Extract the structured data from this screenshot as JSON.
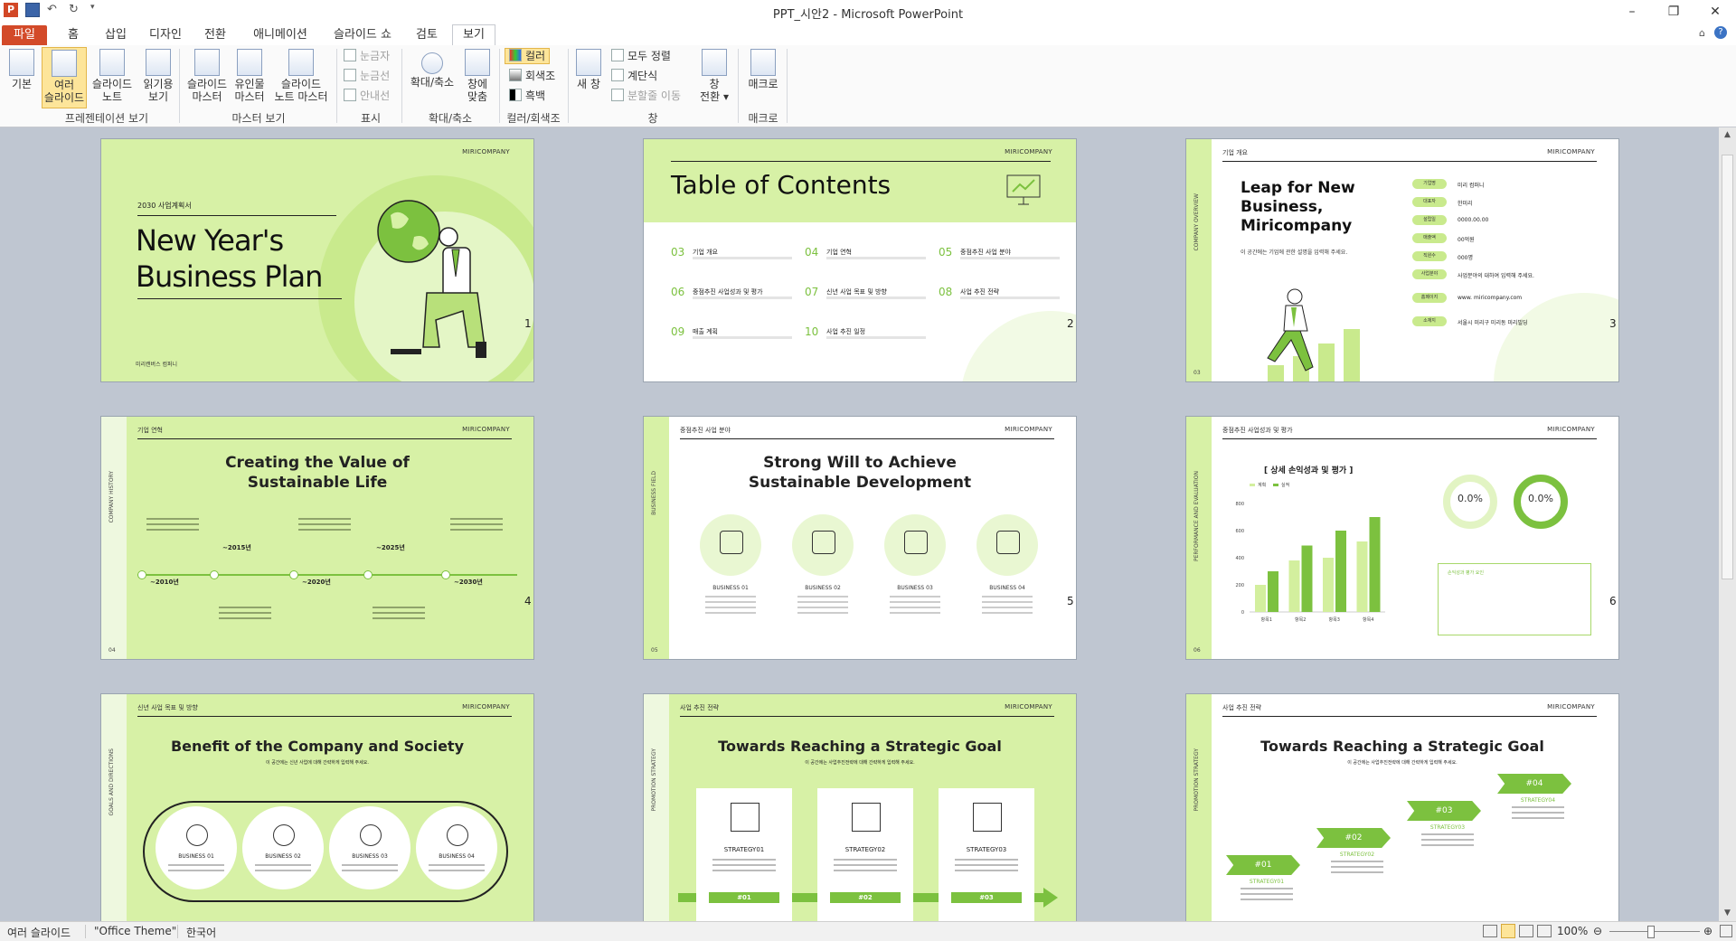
{
  "window": {
    "title": "PPT_시안2  -  Microsoft PowerPoint"
  },
  "tabs": [
    {
      "label": "파일"
    },
    {
      "label": "홈"
    },
    {
      "label": "삽입"
    },
    {
      "label": "디자인"
    },
    {
      "label": "전환"
    },
    {
      "label": "애니메이션"
    },
    {
      "label": "슬라이드 쇼"
    },
    {
      "label": "검토"
    },
    {
      "label": "보기"
    }
  ],
  "ribbon": {
    "pres_views": {
      "normal": "기본",
      "sorter1": "여러",
      "sorter2": "슬라이드",
      "notes1": "슬라이드",
      "notes2": "노트",
      "reading1": "읽기용",
      "reading2": "보기",
      "group": "프레젠테이션 보기"
    },
    "master_views": {
      "slide1": "슬라이드",
      "slide2": "마스터",
      "handout1": "유인물",
      "handout2": "마스터",
      "notes1": "슬라이드",
      "notes2": "노트 마스터",
      "group": "마스터 보기"
    },
    "show": {
      "ruler": "눈금자",
      "grid": "눈금선",
      "guides": "안내선",
      "group": "표시"
    },
    "zoom": {
      "zoom": "확대/축소",
      "fit1": "창에",
      "fit2": "맞춤",
      "group": "확대/축소"
    },
    "color": {
      "color": "컬러",
      "gray": "회색조",
      "bw": "흑백",
      "group": "컬러/회색조"
    },
    "window": {
      "new": "새 창",
      "arrange": "모두 정렬",
      "cascade": "계단식",
      "split": "분할줄 이동",
      "switch1": "창",
      "switch2": "전환",
      "group": "창"
    },
    "macros": {
      "macro": "매크로",
      "group": "매크로"
    }
  },
  "slides": {
    "company": "MIRICOMPANY",
    "s1": {
      "kicker": "2030 사업계획서",
      "title1": "New Year's",
      "title2": "Business Plan",
      "footer": "미리캔버스 컴퍼니",
      "num": "1"
    },
    "s2": {
      "title": "Table of Contents",
      "num": "2",
      "items": [
        {
          "n": "03",
          "t": "기업 개요"
        },
        {
          "n": "04",
          "t": "기업 연혁"
        },
        {
          "n": "05",
          "t": "중점추진 사업 분야"
        },
        {
          "n": "06",
          "t": "중점추진 사업성과 및 평가"
        },
        {
          "n": "07",
          "t": "신년 사업 목표 및 방향"
        },
        {
          "n": "08",
          "t": "사업 추진 전략"
        },
        {
          "n": "09",
          "t": "매출 계획"
        },
        {
          "n": "10",
          "t": "사업 추진 일정"
        }
      ]
    },
    "s3": {
      "sec": "기업 개요",
      "side": "COMPANY OVERVIEW",
      "title1": "Leap for New",
      "title2": "Business,",
      "title3": "Miricompany",
      "desc": "이 공간에는 기업에 관한 설명을 입력해 주세요.",
      "pg": "03",
      "num": "3",
      "rows": [
        {
          "k": "기업명",
          "v": "미리 컴퍼니"
        },
        {
          "k": "대표자",
          "v": "한미리"
        },
        {
          "k": "설립일",
          "v": "0000.00.00"
        },
        {
          "k": "매출액",
          "v": "00억원"
        },
        {
          "k": "직원수",
          "v": "000명"
        },
        {
          "k": "사업분야",
          "v": "사업분야의 대하여 입력해 주세요."
        },
        {
          "k": "홈페이지",
          "v": "www. miricompany.com"
        },
        {
          "k": "소재지",
          "v": "서울시 미리구 미리동 미리빌딩"
        }
      ]
    },
    "s4": {
      "sec": "기업 연혁",
      "side": "COMPANY HISTORY",
      "title1": "Creating the Value of",
      "title2": "Sustainable Life",
      "pg": "04",
      "num": "4",
      "years": [
        "~2010년",
        "~2015년",
        "~2020년",
        "~2025년",
        "~2030년"
      ]
    },
    "s5": {
      "sec": "중점추진 사업 분야",
      "side": "BUSINESS FIELD",
      "title1": "Strong Will to Achieve",
      "title2": "Sustainable Development",
      "pg": "05",
      "num": "5",
      "items": [
        "BUSINESS 01",
        "BUSINESS 02",
        "BUSINESS 03",
        "BUSINESS 04"
      ]
    },
    "s6": {
      "sec": "중점추진 사업성과 및 평가",
      "side": "PERFORMANCE AND EVALUATION",
      "chart_title": "[ 상세 손익성과 및 평가 ]",
      "d1": "0.0%",
      "d2": "0.0%",
      "box": "손익성과 평가 요인",
      "pg": "06",
      "num": "6"
    },
    "s7": {
      "sec": "신년 사업 목표 및 방향",
      "side": "GOALS AND DIRECTIONS",
      "title": "Benefit of the Company and Society",
      "sub": "이 공간에는 신년 사업에 대해 간략하게 입력해 주세요.",
      "items": [
        "BUSINESS 01",
        "BUSINESS 02",
        "BUSINESS 03",
        "BUSINESS 04"
      ]
    },
    "s8": {
      "sec": "사업 추진 전략",
      "side": "PROMOTION STRATEGY",
      "title": "Towards Reaching a Strategic Goal",
      "sub": "이 공간에는 사업추진전략에 대해 간략하게 입력해 주세요.",
      "items": [
        "STRATEGY01",
        "STRATEGY02",
        "STRATEGY03"
      ],
      "tags": [
        "#01",
        "#02",
        "#03"
      ]
    },
    "s9": {
      "sec": "사업 추진 전략",
      "side": "PROMOTION STRATEGY",
      "title": "Towards Reaching a Strategic Goal",
      "sub": "이 공간에는 사업추진전략에 대해 간략하게 입력해 주세요.",
      "tags": [
        "#01",
        "#02",
        "#03",
        "#04"
      ],
      "items": [
        "STRATEGY01",
        "STRATEGY02",
        "STRATEGY03",
        "STRATEGY04"
      ]
    }
  },
  "chart_data": {
    "type": "bar",
    "categories": [
      "항목1",
      "항목2",
      "항목3",
      "항목4"
    ],
    "series": [
      {
        "name": "계획",
        "values": [
          200,
          380,
          400,
          520
        ]
      },
      {
        "name": "실적",
        "values": [
          300,
          490,
          600,
          700
        ]
      }
    ],
    "ylim": [
      0,
      800
    ],
    "yticks": [
      "0",
      "200",
      "400",
      "600",
      "800"
    ],
    "colors": [
      "#d3ef9e",
      "#7cc13f"
    ]
  },
  "status": {
    "view": "여러 슬라이드",
    "theme": "\"Office Theme\"",
    "lang": "한국어",
    "zoom": "100%"
  }
}
